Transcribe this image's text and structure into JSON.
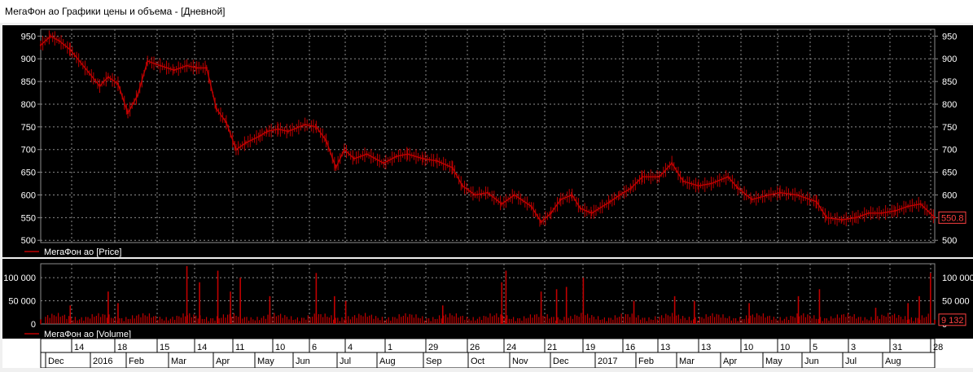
{
  "window": {
    "title": "МегаФон ао Графики цены и объема - [Дневной]"
  },
  "price_panel": {
    "legend": "МегаФон ао [Price]",
    "last_value": "550.8",
    "y_ticks": [
      "950",
      "900",
      "850",
      "800",
      "750",
      "700",
      "650",
      "600",
      "550",
      "500"
    ]
  },
  "volume_panel": {
    "legend": "МегаФон ао [Volume]",
    "last_value": "9 132",
    "y_ticks": [
      "100 000",
      "50 000",
      "0"
    ]
  },
  "x_axis": {
    "days": [
      "14",
      "18",
      "15",
      "14",
      "11",
      "10",
      "6",
      "4",
      "1",
      "29",
      "26",
      "24",
      "21",
      "19",
      "16",
      "13",
      "13",
      "10",
      "10",
      "5",
      "3",
      "31",
      "28"
    ],
    "months": [
      "Dec",
      "2016",
      "Feb",
      "Mar",
      "Apr",
      "May",
      "Jun",
      "Jul",
      "Aug",
      "Sep",
      "Oct",
      "Nov",
      "Dec",
      "2017",
      "Feb",
      "Mar",
      "Apr",
      "May",
      "Jun",
      "Jul",
      "Aug"
    ]
  },
  "colors": {
    "background": "#000000",
    "series": "#c00000",
    "grid": "#8c8c8c",
    "axis_text": "#ffffff",
    "frame": "#f0f0f0"
  },
  "chart_data": [
    {
      "type": "line",
      "title": "",
      "series": [
        {
          "name": "МегаФон ао [Price]"
        }
      ],
      "ylim": [
        495,
        965
      ],
      "x_range": [
        "2015-12-01",
        "2017-08-28"
      ],
      "x": [
        "2015-12-01",
        "2015-12-08",
        "2015-12-14",
        "2015-12-22",
        "2016-01-12",
        "2016-01-18",
        "2016-01-25",
        "2016-02-01",
        "2016-02-08",
        "2016-02-15",
        "2016-02-24",
        "2016-03-05",
        "2016-03-14",
        "2016-03-21",
        "2016-03-28",
        "2016-04-04",
        "2016-04-11",
        "2016-04-18",
        "2016-04-25",
        "2016-05-05",
        "2016-05-10",
        "2016-05-18",
        "2016-05-25",
        "2016-06-06",
        "2016-06-14",
        "2016-06-21",
        "2016-06-28",
        "2016-07-04",
        "2016-07-11",
        "2016-07-20",
        "2016-08-01",
        "2016-08-10",
        "2016-08-18",
        "2016-08-29",
        "2016-09-08",
        "2016-09-19",
        "2016-09-26",
        "2016-10-05",
        "2016-10-14",
        "2016-10-24",
        "2016-11-02",
        "2016-11-14",
        "2016-11-21",
        "2016-11-28",
        "2016-12-05",
        "2016-12-13",
        "2016-12-19",
        "2016-12-27",
        "2017-01-09",
        "2017-01-16",
        "2017-01-24",
        "2017-02-01",
        "2017-02-13",
        "2017-02-22",
        "2017-03-02",
        "2017-03-13",
        "2017-03-22",
        "2017-04-03",
        "2017-04-10",
        "2017-04-20",
        "2017-05-02",
        "2017-05-10",
        "2017-05-22",
        "2017-06-05",
        "2017-06-12",
        "2017-06-23",
        "2017-07-03",
        "2017-07-12",
        "2017-07-21",
        "2017-07-31",
        "2017-08-09",
        "2017-08-18",
        "2017-08-28"
      ],
      "y": [
        930,
        950,
        940,
        920,
        840,
        860,
        845,
        780,
        820,
        895,
        885,
        875,
        885,
        880,
        880,
        790,
        760,
        700,
        715,
        730,
        740,
        745,
        740,
        755,
        750,
        720,
        660,
        700,
        680,
        690,
        670,
        685,
        690,
        680,
        675,
        660,
        620,
        600,
        605,
        580,
        600,
        575,
        540,
        560,
        590,
        600,
        570,
        560,
        585,
        600,
        615,
        640,
        640,
        670,
        630,
        620,
        625,
        640,
        615,
        590,
        600,
        605,
        600,
        585,
        550,
        545,
        550,
        560,
        560,
        565,
        575,
        580,
        550
      ]
    },
    {
      "type": "bar",
      "title": "",
      "series": [
        {
          "name": "МегаФон ао [Volume]"
        }
      ],
      "ylim": [
        0,
        130000
      ],
      "x_range": [
        "2015-12-01",
        "2017-08-28"
      ],
      "x": [
        "2015-12-01",
        "2015-12-22",
        "2016-01-18",
        "2016-01-25",
        "2016-03-14",
        "2016-03-23",
        "2016-04-05",
        "2016-04-14",
        "2016-04-21",
        "2016-05-12",
        "2016-06-14",
        "2016-06-27",
        "2016-07-05",
        "2016-09-12",
        "2016-10-24",
        "2016-10-27",
        "2016-11-21",
        "2016-12-02",
        "2016-12-09",
        "2016-12-21",
        "2017-01-26",
        "2017-02-24",
        "2017-03-10",
        "2017-04-18",
        "2017-05-23",
        "2017-06-07",
        "2017-07-17",
        "2017-08-09",
        "2017-08-17",
        "2017-08-25",
        "2017-08-28"
      ],
      "y": [
        10000,
        40000,
        70000,
        45000,
        125000,
        90000,
        115000,
        70000,
        100000,
        60000,
        110000,
        60000,
        50000,
        40000,
        90000,
        115000,
        70000,
        75000,
        80000,
        100000,
        50000,
        60000,
        50000,
        45000,
        60000,
        75000,
        35000,
        45000,
        60000,
        110000,
        9132
      ]
    }
  ]
}
